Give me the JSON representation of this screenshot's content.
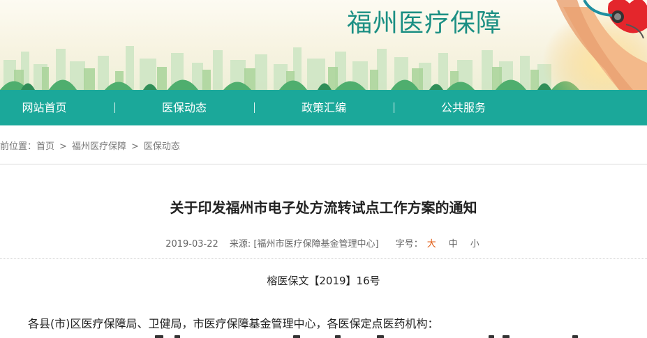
{
  "banner": {
    "site_title": "福州医疗保障"
  },
  "nav": {
    "items": [
      {
        "label": "网站首页"
      },
      {
        "label": "医保动态"
      },
      {
        "label": "政策汇编"
      },
      {
        "label": "公共服务"
      }
    ]
  },
  "breadcrumb": {
    "prefix": "前位置：",
    "items": [
      "首页",
      "福州医疗保障",
      "医保动态"
    ],
    "separator": ">"
  },
  "article": {
    "title": "关于印发福州市电子处方流转试点工作方案的通知",
    "date": "2019-03-22",
    "source": "来源: [福州市医疗保障基金管理中心]",
    "font_size_label": "字号：",
    "font_sizes": [
      "大",
      "中",
      "小"
    ],
    "doc_number": "榕医保文【2019】16号",
    "salutation": "各县(市)区医疗保障局、卫健局，市医疗保障基金管理中心，各医保定点医药机构："
  },
  "colors": {
    "nav_bg": "#1ba89a",
    "title_green": "#1b8f83",
    "active_font_size": "#e05a12"
  },
  "icons": {
    "banner_decoration": "city-skyline-illustration",
    "banner_corner": "stethoscope-heart-hands-icon"
  }
}
